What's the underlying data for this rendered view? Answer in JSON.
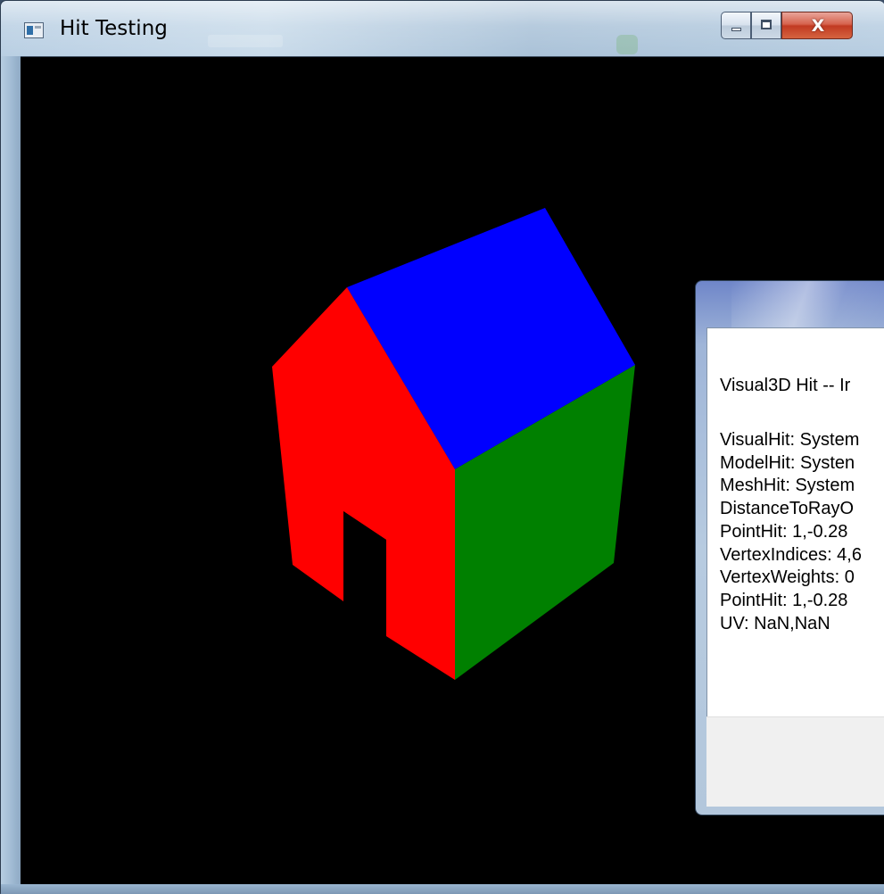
{
  "window": {
    "title": "Hit Testing",
    "icon": "wpf-app-icon",
    "buttons": {
      "minimize": "minimize-icon",
      "maximize": "maximize-icon",
      "close": "X"
    }
  },
  "scene": {
    "background": "#000000",
    "house": {
      "roof_color": "#0000ff",
      "front_color": "#ff0000",
      "side_color": "#008000",
      "door_color": "#000000"
    }
  },
  "dialog": {
    "heading": "Visual3D Hit -- Ir",
    "lines": [
      "VisualHit: System",
      "ModelHit: Systen",
      "MeshHit: System",
      "DistanceToRayO",
      "PointHit: 1,-0.28",
      "VertexIndices: 4,6",
      "VertexWeights: 0",
      "PointHit: 1,-0.28",
      "UV: NaN,NaN"
    ]
  }
}
